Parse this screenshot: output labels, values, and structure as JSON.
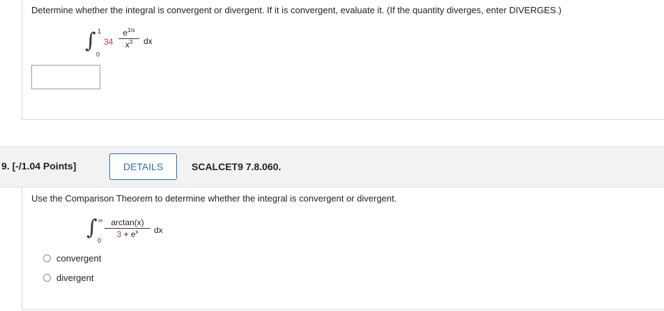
{
  "prev_question": {
    "prompt": "Determine whether the integral is convergent or divergent. If it is convergent, evaluate it. (If the quantity diverges, enter DIVERGES.)",
    "integral": {
      "lower": "0",
      "upper": "1",
      "coefficient": "34",
      "numerator_base": "e",
      "numerator_exp": "1/x",
      "denominator_base": "x",
      "denominator_exp": "3",
      "differential": "dx"
    },
    "answer_value": ""
  },
  "question": {
    "number_points": "9.  [-/1.04 Points]",
    "details_label": "DETAILS",
    "source": "SCALCET9 7.8.060.",
    "prompt": "Use the Comparison Theorem to determine whether the integral is convergent or divergent.",
    "integral": {
      "lower": "0",
      "upper": "∞",
      "numerator": "arctan(x)",
      "denominator_const": "3",
      "denominator_plus": "+",
      "denominator_base": "e",
      "denominator_exp": "x",
      "differential": "dx"
    },
    "options": [
      "convergent",
      "divergent"
    ],
    "selected": null
  },
  "colors": {
    "accent_blue": "#2a6fb0",
    "highlight_red": "#c0392b",
    "header_bg": "#f2f2f2"
  }
}
